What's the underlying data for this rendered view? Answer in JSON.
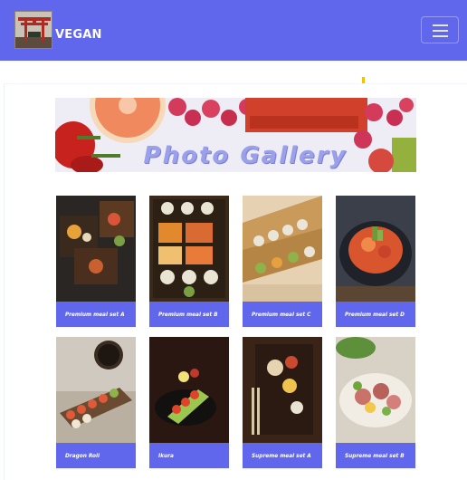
{
  "header": {
    "brand": "VEGAN",
    "logo_icon": "torii-gate-icon",
    "menu_icon": "hamburger-menu-icon",
    "colors": {
      "navbar": "#6067ec",
      "caption_bg": "#6067ec"
    }
  },
  "banner": {
    "title": "Photo  Gallery"
  },
  "gallery": {
    "items": [
      {
        "caption": "Premium meal set A"
      },
      {
        "caption": "Premium meal set B"
      },
      {
        "caption": "Premium meal set C"
      },
      {
        "caption": "Premium meal set D"
      },
      {
        "caption": "Dragon Roll"
      },
      {
        "caption": "Ikura"
      },
      {
        "caption": "Supreme meal set A"
      },
      {
        "caption": "Supreme meal set B"
      }
    ]
  }
}
